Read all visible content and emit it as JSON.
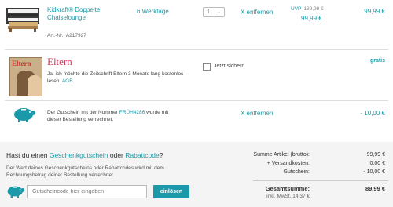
{
  "product": {
    "name": "Kidkraft® Doppelte Chaiselounge",
    "art_nr": "Art.-Nr.: A217927",
    "delivery": "6 Werktage",
    "quantity": "1",
    "remove_label": "X entfernen",
    "uvp_label": "UVP",
    "uvp_old_price": "139,99 €",
    "new_price": "99,99 €",
    "total_price": "99,99 €"
  },
  "magazine": {
    "cover_title": "Eltern",
    "brand": "Eltern",
    "text_before_link": "Ja, ich möchte die Zeitschrift Eltern 3 Monate lang kostenlos lesen.",
    "agb_link": "AGB",
    "checkbox_label": "Jetzt sichern",
    "price": "gratis"
  },
  "voucher_row": {
    "text_before_code": "Der Gutschein mit der Nummer",
    "code": "FRÜH4286",
    "text_after_code": "wurde mit dieser Bestellung verrechnet.",
    "remove_label": "X entfernen",
    "price": "- 10,00 €"
  },
  "redeem": {
    "question_prefix": "Hast du einen",
    "gift_link": "Geschenkgutschein",
    "question_middle": "oder",
    "rabatt_link": "Rabattcode",
    "question_suffix": "?",
    "info": "Der Wert deines Geschenkgutscheins oder Rabattcodes wird mit dem Rechnungsbetrag deiner Bestellung verrechnet.",
    "placeholder": "Gutscheincode hier eingeben",
    "button_label": "einlösen"
  },
  "summary": {
    "subtotal_label": "Summe Artikel (brutto):",
    "subtotal_value": "99,99 €",
    "shipping_label": "+ Versandkosten:",
    "shipping_value": "0,00 €",
    "voucher_label": "Gutschein:",
    "voucher_value": "- 10,00 €",
    "total_label": "Gesamtsumme:",
    "total_value": "89,99 €",
    "vat_label": "inkl. MwSt. 14,37 €",
    "vat_value": "14,37 €"
  },
  "colors": {
    "accent": "#1a9aa8",
    "brand_pink": "#d23a5e"
  }
}
